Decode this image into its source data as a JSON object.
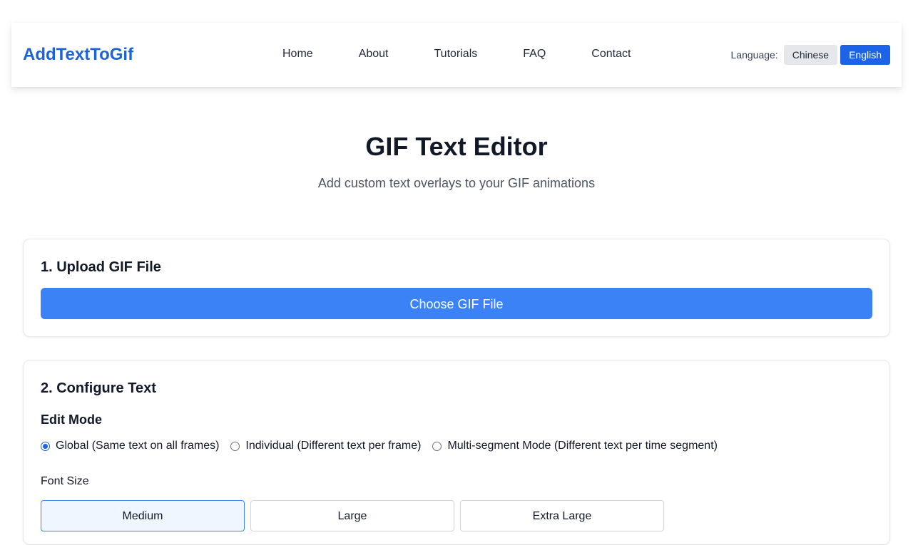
{
  "header": {
    "brand": "AddTextToGif",
    "nav": [
      "Home",
      "About",
      "Tutorials",
      "FAQ",
      "Contact"
    ],
    "language": {
      "label": "Language:",
      "options": [
        "Chinese",
        "English"
      ],
      "selected": "English"
    }
  },
  "hero": {
    "title": "GIF Text Editor",
    "subtitle": "Add custom text overlays to your GIF animations"
  },
  "upload": {
    "title": "1. Upload GIF File",
    "button": "Choose GIF File"
  },
  "configure": {
    "title": "2. Configure Text",
    "edit_mode": {
      "title": "Edit Mode",
      "options": [
        "Global (Same text on all frames)",
        "Individual (Different text per frame)",
        "Multi-segment Mode (Different text per time segment)"
      ],
      "selected_index": 0
    },
    "font_size": {
      "label": "Font Size",
      "options": [
        "Medium",
        "Large",
        "Extra Large"
      ],
      "selected_index": 0
    }
  },
  "colors": {
    "brand": "#1d63d8",
    "primary_button": "#3b82f6",
    "active_lang": "#1d63e8"
  }
}
